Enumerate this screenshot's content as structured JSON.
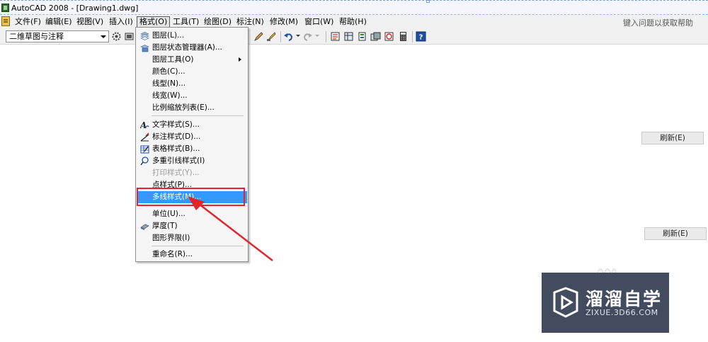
{
  "title_bar": {
    "title": "AutoCAD 2008 - [Drawing1.dwg]"
  },
  "menubar": {
    "items": [
      {
        "label": "文件(F)"
      },
      {
        "label": "编辑(E)"
      },
      {
        "label": "视图(V)"
      },
      {
        "label": "插入(I)"
      },
      {
        "label": "格式(O)"
      },
      {
        "label": "工具(T)"
      },
      {
        "label": "绘图(D)"
      },
      {
        "label": "标注(N)"
      },
      {
        "label": "修改(M)"
      },
      {
        "label": "窗口(W)"
      },
      {
        "label": "帮助(H)"
      }
    ],
    "active_menu": "格式(O)",
    "help_search_placeholder": "键入问题以获取帮助"
  },
  "toolbar": {
    "workspace_value": "二维草图与注释",
    "icons": [
      "workspace-settings-icon",
      "layer-icon",
      "pencil-icon",
      "match-properties-icon",
      "undo-icon",
      "redo-icon",
      "properties-icon",
      "design-center-icon",
      "tool-palette-icon",
      "sheet-set-icon",
      "markup-icon",
      "calculator-icon",
      "help-icon"
    ]
  },
  "format_menu": {
    "items": [
      {
        "label": "图层(L)...",
        "icon": "layers-icon"
      },
      {
        "label": "图层状态管理器(A)...",
        "icon": "layer-state-icon"
      },
      {
        "label": "图层工具(O)",
        "submenu": true
      },
      {
        "label": "颜色(C)..."
      },
      {
        "label": "线型(N)..."
      },
      {
        "label": "线宽(W)..."
      },
      {
        "label": "比例缩放列表(E)..."
      },
      {
        "label": "文字样式(S)...",
        "icon": "text-style-icon"
      },
      {
        "label": "标注样式(D)...",
        "icon": "dimension-style-icon"
      },
      {
        "label": "表格样式(B)...",
        "icon": "table-style-icon"
      },
      {
        "label": "多重引线样式(I)",
        "icon": "mleader-style-icon"
      },
      {
        "label": "打印样式(Y)...",
        "disabled": true
      },
      {
        "label": "点样式(P)..."
      },
      {
        "label": "多线样式(M)...",
        "highlighted": true
      },
      {
        "label": "单位(U)..."
      },
      {
        "label": "厚度(T)",
        "icon": "thickness-icon"
      },
      {
        "label": "图形界限(I)"
      },
      {
        "label": "重命名(R)..."
      }
    ]
  },
  "right_panel": {
    "refresh_button_1": "刷新(E)",
    "refresh_button_2": "刷新(E)"
  },
  "watermark": {
    "brand_cn": "溜溜自学",
    "brand_url": "ZIXUE.3D66.COM"
  },
  "colors": {
    "menu_highlight": "#3399ff",
    "callout_red": "#e0262b",
    "watermark_bg": "#434b5e"
  }
}
